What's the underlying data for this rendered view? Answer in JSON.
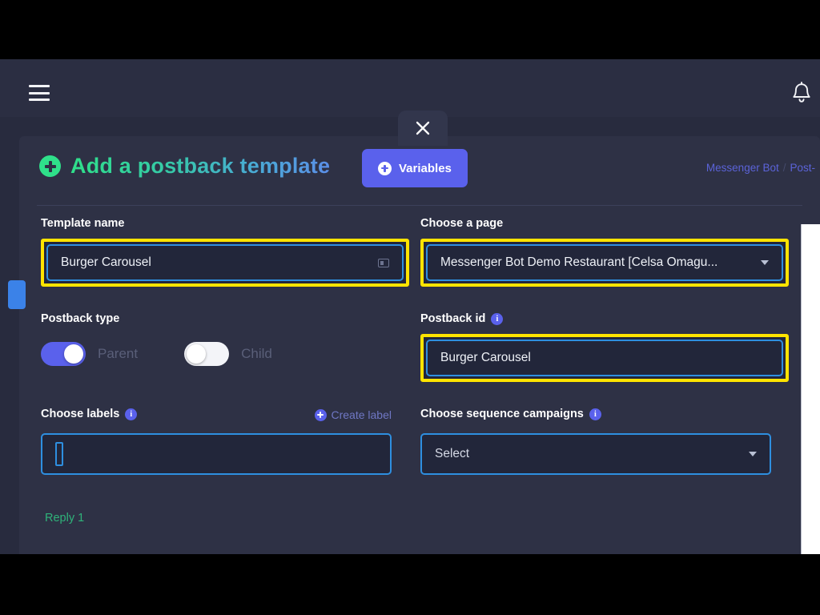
{
  "topbar": {
    "menu_icon": "hamburger-menu-icon",
    "notification_icon": "bell-icon"
  },
  "modal": {
    "close_icon": "close-icon",
    "title": "Add a postback template",
    "title_plus_icon": "plus-circle-icon",
    "variables_button": "Variables",
    "variables_plus_icon": "plus-circle-icon",
    "breadcrumb": {
      "root": "Messenger Bot",
      "separator": "/",
      "current": "Post-"
    }
  },
  "form": {
    "template_name": {
      "label": "Template name",
      "value": "Burger Carousel",
      "placeholder": "Template name",
      "highlighted": true,
      "trailing_icon": "textarea-resize-icon"
    },
    "choose_page": {
      "label": "Choose a page",
      "value": "Messenger Bot Demo Restaurant [Celsa Omagu...",
      "highlighted": true,
      "caret_icon": "chevron-down-icon"
    },
    "postback_type": {
      "label": "Postback type",
      "parent": {
        "label": "Parent",
        "on": true
      },
      "child": {
        "label": "Child",
        "on": false
      }
    },
    "postback_id": {
      "label": "Postback id",
      "info_icon": "info-icon",
      "info_glyph": "i",
      "value": "Burger Carousel",
      "placeholder": "Postback id",
      "highlighted": true
    },
    "choose_labels": {
      "label": "Choose labels",
      "info_icon": "info-icon",
      "info_glyph": "i",
      "value": "",
      "create_label_link": "Create label",
      "create_label_icon": "plus-circle-icon"
    },
    "sequence_campaigns": {
      "label": "Choose sequence campaigns",
      "info_icon": "info-icon",
      "info_glyph": "i",
      "value": "Select",
      "caret_icon": "chevron-down-icon"
    },
    "reply": {
      "title": "Reply 1"
    }
  },
  "colors": {
    "highlight": "#ffe400",
    "input_border": "#2e8fe0",
    "accent_purple": "#5a61ec",
    "accent_green": "#2fe08a",
    "page_bg": "#282b3e",
    "modal_bg": "#2e3145",
    "field_bg": "#22263a"
  }
}
